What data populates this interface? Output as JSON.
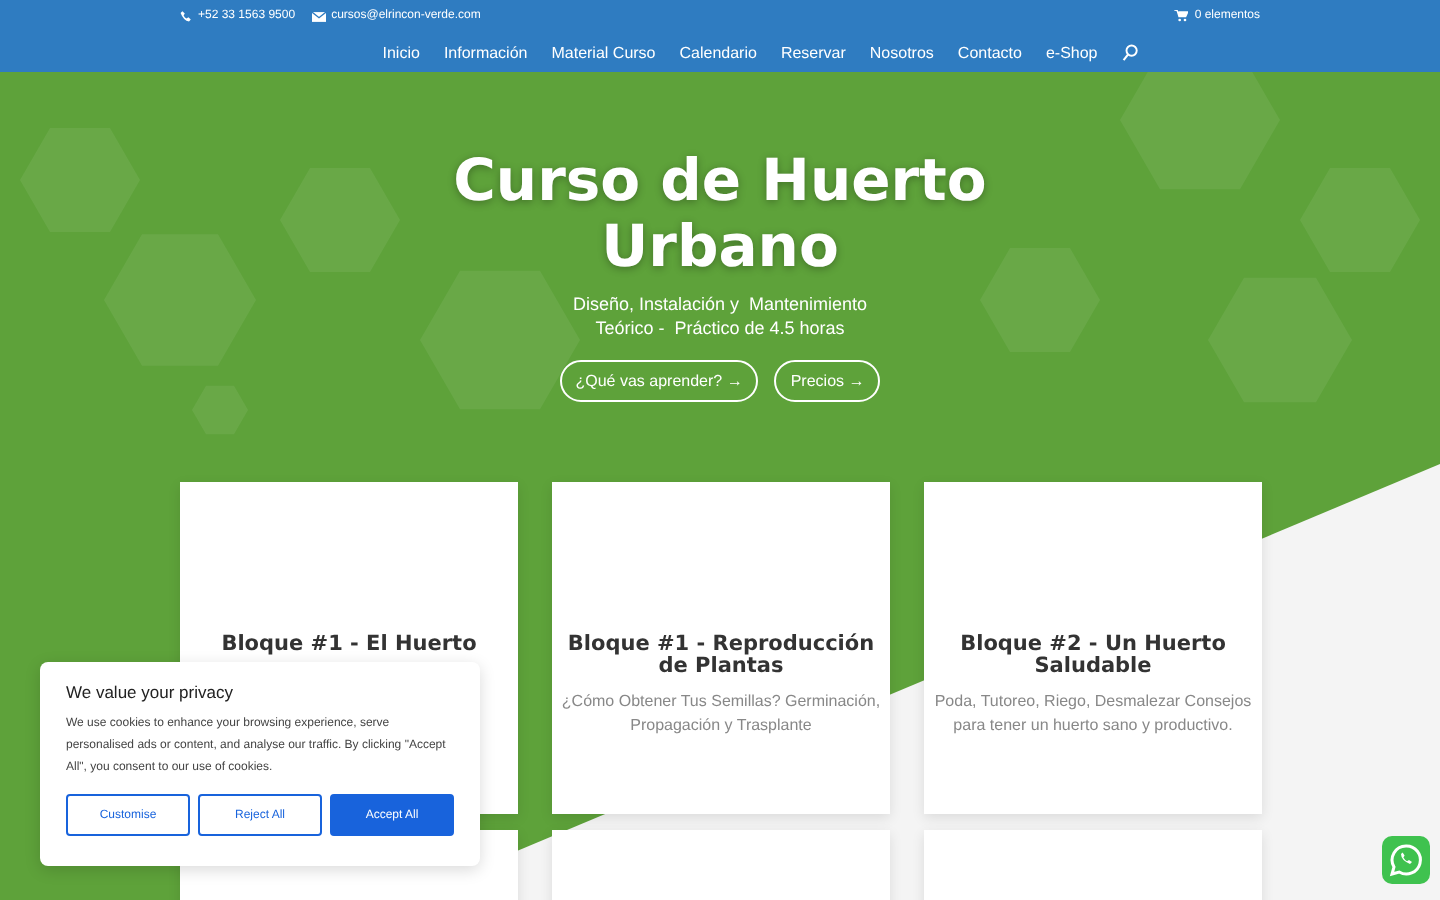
{
  "top_bar": {
    "phone": "+52 33 1563 9500",
    "email": "cursos@elrincon-verde.com",
    "cart": "0 elementos"
  },
  "nav": {
    "items": [
      {
        "label": "Inicio"
      },
      {
        "label": "Información"
      },
      {
        "label": "Material Curso"
      },
      {
        "label": "Calendario"
      },
      {
        "label": "Reservar"
      },
      {
        "label": "Nosotros"
      },
      {
        "label": "Contacto"
      },
      {
        "label": "e-Shop"
      }
    ]
  },
  "hero": {
    "title": "Curso de Huerto Urbano",
    "subtitle_lines": [
      "Diseño, Instalación y  Mantenimiento",
      "Teórico -  Práctico de 4.5 horas"
    ],
    "buttons": [
      {
        "label": "¿Qué vas aprender?",
        "arrow": "→"
      },
      {
        "label": "Precios",
        "arrow": "→"
      }
    ]
  },
  "cards": [
    {
      "title": "Bloque #1 - El Huerto"
    },
    {
      "title": "Bloque #1 - Reproducción de Plantas",
      "description": "¿Cómo Obtener Tus Semillas? Germinación,  Propagación y Trasplante"
    },
    {
      "title": "Bloque #2 - Un Huerto Saludable",
      "description": "Poda, Tutoreo,  Riego,  Desmalezar Consejos para tener un huerto sano y productivo."
    }
  ],
  "cookie_banner": {
    "title": "We value your privacy",
    "text": "We use cookies to enhance your browsing experience, serve personalised ads or content, and analyse our traffic.  By clicking \"Accept All\", you consent to our use of cookies.",
    "buttons": [
      {
        "label": "Customise",
        "kind": "outline"
      },
      {
        "label": "Reject All",
        "kind": "outline"
      },
      {
        "label": "Accept All",
        "kind": "primary"
      }
    ]
  }
}
